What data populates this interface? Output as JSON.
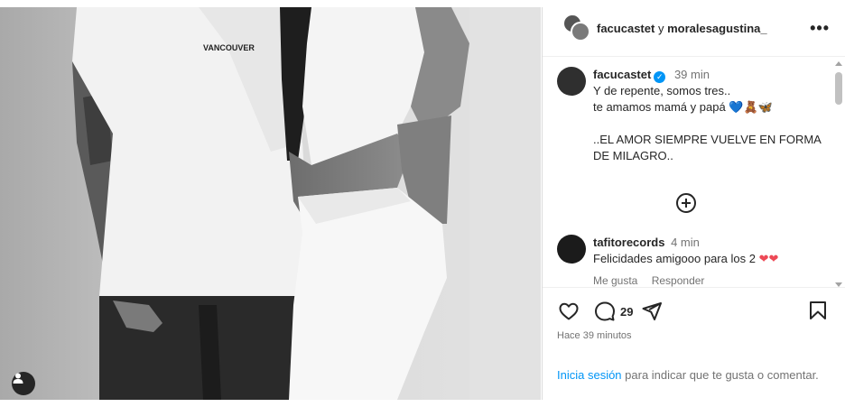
{
  "post": {
    "authors": {
      "primary": "facucastet",
      "connector": "y",
      "secondary": "moralesagustina_"
    },
    "photo": {
      "shirt_text": "VANCOUVER",
      "user_tag_icon": "person-icon"
    },
    "more_icon": "more-options-icon",
    "caption": {
      "username": "facucastet",
      "verified_icon": "verified-badge-icon",
      "time": "39 min",
      "line1": "Y de repente, somos tres..",
      "line2": " te amamos mamá y papá",
      "emojis": "💙🧸🦋",
      "line3": "..EL AMOR SIEMPRE VUELVE EN FORMA DE MILAGRO.."
    },
    "load_more_icon": "plus-circle-icon",
    "comments": [
      {
        "username": "tafitorecords",
        "time": "4 min",
        "text": "Felicidades amigooo para los 2",
        "emojis": "❤❤",
        "like_label": "Me gusta",
        "reply_label": "Responder"
      }
    ],
    "actions": {
      "like_icon": "heart-icon",
      "comment_icon": "comment-icon",
      "comment_count": "29",
      "share_icon": "share-icon",
      "save_icon": "bookmark-icon"
    },
    "timestamp": "Hace 39 minutos",
    "login_prompt": {
      "link": "Inicia sesión",
      "text": " para indicar que te gusta o comentar."
    }
  }
}
